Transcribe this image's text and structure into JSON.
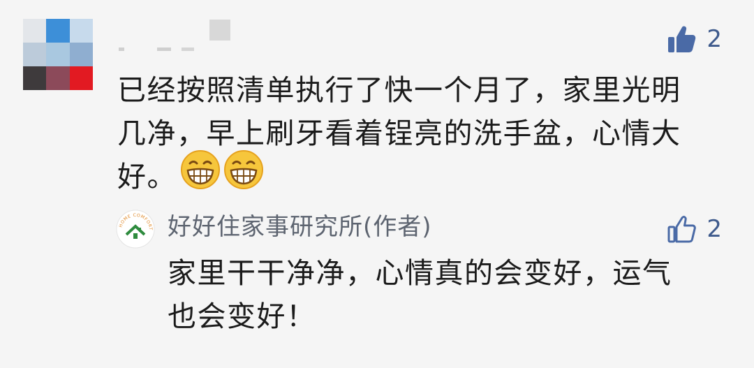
{
  "comment": {
    "text_lines": [
      "已经按照清单执行了快一个月了，家里光明",
      "几净，早上刷牙看着锃亮的洗手盆，心情大",
      "好。"
    ],
    "emojis": [
      "grinning-face-icon",
      "grinning-face-icon"
    ],
    "like_count": "2",
    "liked": true
  },
  "reply": {
    "author": "好好住家事研究所(作者)",
    "logo_text": "HOME COMFORTS",
    "text_lines": [
      "家里干干净净，心情真的会变好，运气",
      "也会变好！"
    ],
    "like_count": "2",
    "liked": false
  },
  "colors": {
    "background": "#f5f5f5",
    "like_filled": "#4a6aa6",
    "like_count": "#3e5a8c",
    "author_name": "#5d6470",
    "logo_green": "#2e8b3e",
    "logo_orange": "#e08a2a"
  }
}
